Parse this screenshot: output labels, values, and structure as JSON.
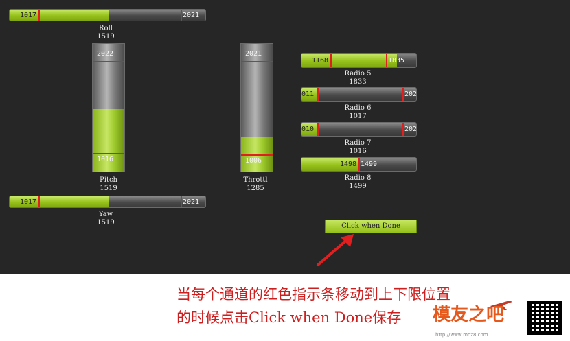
{
  "roll": {
    "min": "1017",
    "max": "2021",
    "name": "Roll",
    "value": "1519",
    "fill_fraction": 0.51
  },
  "pitch": {
    "min": "1016",
    "max": "2022",
    "name": "Pitch",
    "value": "1519",
    "fill_fraction": 0.49
  },
  "yaw": {
    "min": "1017",
    "max": "2021",
    "name": "Yaw",
    "value": "1519",
    "fill_fraction": 0.51
  },
  "throttle": {
    "min": "1006",
    "max": "2021",
    "name": "Throttl",
    "value": "1285",
    "fill_fraction": 0.27
  },
  "radio5": {
    "min": "1168",
    "max": "1835",
    "name": "Radio 5",
    "value": "1833",
    "fill_fraction": 0.83
  },
  "radio6": {
    "min": "011",
    "max": "202",
    "name": "Radio 6",
    "value": "1017",
    "fill_fraction": 0.01
  },
  "radio7": {
    "min": "010",
    "max": "202",
    "name": "Radio 7",
    "value": "1016",
    "fill_fraction": 0.01
  },
  "radio8": {
    "min": "1498",
    "max": "1499",
    "name": "Radio 8",
    "value": "1499",
    "fill_fraction": 0.5
  },
  "done_button": {
    "label": "Click when Done"
  },
  "note": {
    "line1": "当每个通道的红色指示条移动到上下限位置",
    "line2": "的时候点击Click when Done保存"
  },
  "watermark": {
    "brand": "模友之吧",
    "url": "http://www.moz8.com"
  },
  "colors": {
    "fill_green": "#97c21a",
    "limit_marker": "#e02020",
    "annotation_red": "#cc1f1f",
    "background": "#262626"
  },
  "icons": {
    "arrow": "red-arrow-icon",
    "logo_plane": "plane-icon",
    "qr": "qr-code-icon"
  }
}
